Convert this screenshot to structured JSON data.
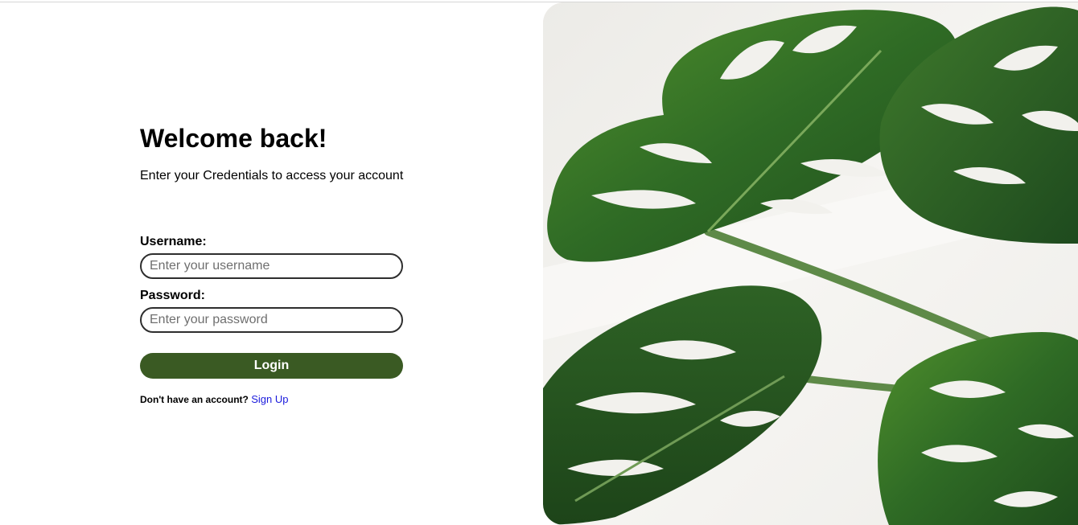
{
  "login": {
    "title": "Welcome back!",
    "subtitle": "Enter your Credentials to access your account",
    "username_label": "Username:",
    "username_placeholder": "Enter your username",
    "password_label": "Password:",
    "password_placeholder": "Enter your password",
    "login_button": "Login",
    "signup_prompt": "Don't have an account?",
    "signup_link": "Sign Up"
  },
  "theme": {
    "accent": "#3a5a23",
    "link": "#1a1adc"
  },
  "hero": {
    "icon": "monstera-leaves-photo"
  }
}
